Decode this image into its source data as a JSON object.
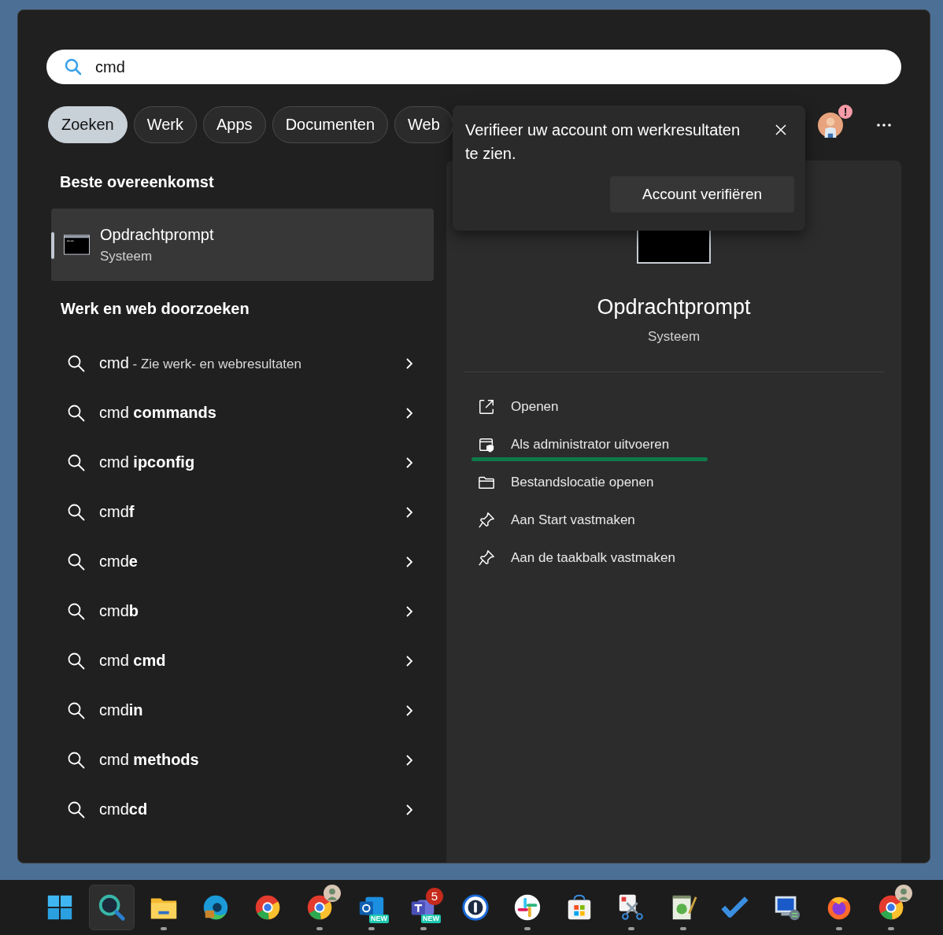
{
  "search": {
    "value": "cmd"
  },
  "filters": [
    {
      "label": "Zoeken",
      "selected": true
    },
    {
      "label": "Werk",
      "selected": false
    },
    {
      "label": "Apps",
      "selected": false
    },
    {
      "label": "Documenten",
      "selected": false
    },
    {
      "label": "Web",
      "selected": false
    }
  ],
  "notification": {
    "text": "Verifieer uw account om werkresultaten te zien.",
    "button": "Account verifiëren",
    "alert_badge": "!"
  },
  "best_match": {
    "heading": "Beste overeenkomst",
    "title": "Opdrachtprompt",
    "subtitle": "Systeem",
    "selected": true
  },
  "web_search": {
    "heading": "Werk en web doorzoeken",
    "items": [
      {
        "text": "cmd",
        "hint": "- Zie werk- en webresultaten"
      },
      {
        "text": "cmd **commands**"
      },
      {
        "text": "cmd **ipconfig**"
      },
      {
        "text": "cmd**f**"
      },
      {
        "text": "cmd**e**"
      },
      {
        "text": "cmd**b**"
      },
      {
        "text": "cmd **cmd**"
      },
      {
        "text": "cmd**in**"
      },
      {
        "text": "cmd **methods**"
      },
      {
        "text": "cmd**cd**"
      }
    ]
  },
  "details": {
    "title": "Opdrachtprompt",
    "subtitle": "Systeem",
    "actions": [
      {
        "kind": "open",
        "label": "Openen",
        "underlined": false
      },
      {
        "kind": "admin",
        "label": "Als administrator uitvoeren",
        "underlined": true
      },
      {
        "kind": "folder",
        "label": "Bestandslocatie openen",
        "underlined": false
      },
      {
        "kind": "pin",
        "label": "Aan Start vastmaken",
        "underlined": false
      },
      {
        "kind": "pin",
        "label": "Aan de taakbalk vastmaken",
        "underlined": false
      }
    ]
  },
  "taskbar": [
    {
      "kind": "start",
      "running": false,
      "selected": false
    },
    {
      "kind": "search",
      "running": false,
      "selected": true
    },
    {
      "kind": "folder",
      "running": true,
      "selected": false
    },
    {
      "kind": "edge",
      "running": false,
      "selected": false
    },
    {
      "kind": "chrome",
      "running": false,
      "selected": false
    },
    {
      "kind": "chrome",
      "running": true,
      "selected": false,
      "avatar": true
    },
    {
      "kind": "outlook",
      "running": true,
      "selected": false,
      "tag": "NEW"
    },
    {
      "kind": "teams",
      "running": true,
      "selected": false,
      "tag": "NEW",
      "count": "5"
    },
    {
      "kind": "password",
      "running": false,
      "selected": false
    },
    {
      "kind": "slack",
      "running": true,
      "selected": false
    },
    {
      "kind": "store",
      "running": false,
      "selected": false
    },
    {
      "kind": "snip",
      "running": true,
      "selected": false
    },
    {
      "kind": "notepad",
      "running": true,
      "selected": false
    },
    {
      "kind": "todo",
      "running": false,
      "selected": false
    },
    {
      "kind": "remote",
      "running": false,
      "selected": false
    },
    {
      "kind": "firefox",
      "running": true,
      "selected": false
    },
    {
      "kind": "chrome",
      "running": true,
      "selected": false,
      "avatar": true
    }
  ]
}
